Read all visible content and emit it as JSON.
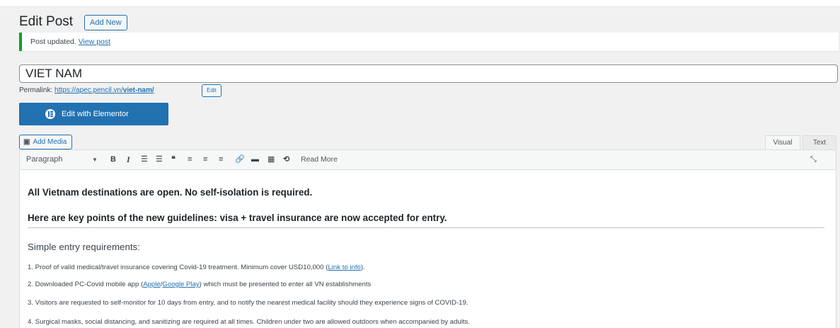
{
  "header": {
    "title": "Edit Post",
    "add_new": "Add New"
  },
  "notice": {
    "text": "Post updated.",
    "link": "View post"
  },
  "post": {
    "title": "VIET NAM"
  },
  "permalink": {
    "label": "Permalink:",
    "url_base": "https://apec.pencil.vn/",
    "url_slug": "viet-nam/",
    "edit": "Edit"
  },
  "elementor": {
    "label": "Edit with Elementor"
  },
  "editor": {
    "add_media": "Add Media",
    "tabs": {
      "visual": "Visual",
      "text": "Text"
    },
    "toolbar": {
      "format": "Paragraph",
      "bold": "B",
      "italic": "I",
      "unordered_list": "☰",
      "ordered_list": "☰",
      "blockquote": "❝",
      "align_left": "≡",
      "align_center": "≡",
      "align_right": "≡",
      "link": "🔗",
      "read_more_tag": "▬",
      "kitchen_sink": "▦",
      "toggle": "⟲",
      "read_more": "Read More",
      "fullscreen": "⤡"
    },
    "icons": [
      "dropdown-arrow-icon",
      "bold-icon",
      "italic-icon",
      "bulleted-list-icon",
      "numbered-list-icon",
      "blockquote-icon",
      "align-left-icon",
      "align-center-icon",
      "align-right-icon",
      "link-icon",
      "read-more-tag-icon",
      "toolbar-toggle-icon",
      "distraction-free-icon",
      "fullscreen-icon"
    ]
  },
  "content": {
    "heading1": "All Vietnam destinations are open. No self-isolation is required.",
    "heading2": "Here are key points of the new guidelines: visa + travel insurance are now accepted for entry.",
    "subheading": "Simple entry requirements:",
    "item1": {
      "text": "1. Proof of valid medical/travel insurance covering Covid-19 treatment. Minimum cover USD10,000 (",
      "link": "Link to info",
      "end": ")."
    },
    "item2": {
      "text": "2. Downloaded PC-Covid mobile app (",
      "link1": "Apple",
      "sep": "/",
      "link2": "Google Play",
      "end": ") which must be presented to enter all VN establishments"
    },
    "item3": "3. Visitors are requested to self-monitor for 10 days from entry, and to notify the nearest medical facility should they experience signs of COVID-19.",
    "item4": "4. Surgical masks, social distancing, and sanitizing are required at all times. Children under two are allowed outdoors when accompanied by adults."
  },
  "colors": {
    "accent": "#2271b1",
    "success": "#00a32a"
  }
}
